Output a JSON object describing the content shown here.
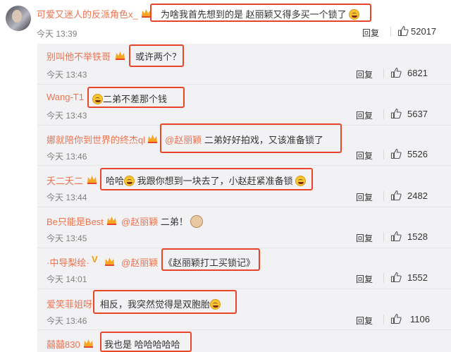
{
  "main_comment": {
    "user": "可爱又迷人的反派角色x_",
    "text": "为啥我首先想到的是 赵丽颖又得多买一个锁了",
    "time": "今天 13:39",
    "reply": "回复",
    "likes": "52017"
  },
  "replies": [
    {
      "user": "别叫他不举铁哥",
      "text": "或许两个？",
      "time": "今天 13:43",
      "reply": "回复",
      "likes": "6821"
    },
    {
      "user": "Wang-T1",
      "text": "二弟不差那个钱",
      "time": "今天 13:43",
      "reply": "回复",
      "likes": "5637"
    },
    {
      "user": "娜就陪你到世界的终杰ql",
      "mention": "@赵丽颖",
      "text": " 二弟好好拍戏，又该准备锁了",
      "time": "今天 13:46",
      "reply": "回复",
      "likes": "5526"
    },
    {
      "user": "夭二夭二",
      "text_a": "哈哈",
      "text_b": " 我跟你想到一块去了，小赵赶紧准备锁",
      "time": "今天 13:44",
      "reply": "回复",
      "likes": "2482"
    },
    {
      "user": "Be只能是Best",
      "mention": "@赵丽颖",
      "text": " 二弟！",
      "time": "今天 13:45",
      "reply": "回复",
      "likes": "1528"
    },
    {
      "user": "·中导梨绘·",
      "mention": "@赵丽颖",
      "text": "《赵丽颖打工买锁记》",
      "time": "今天 14:01",
      "reply": "回复",
      "likes": "1552"
    },
    {
      "user": "爱笑菲姐呀",
      "text": "相反，我突然觉得是双胞胎",
      "time": "今天 13:46",
      "reply": "回复",
      "likes": "1106"
    },
    {
      "user": "囍囍830",
      "text": "我也是 哈哈哈哈哈"
    }
  ],
  "colors": {
    "username": "#eb7350",
    "highlight_box": "#e8452b",
    "panel": "#f2f2f5"
  },
  "icons": {
    "like": "thumbs-up-icon",
    "badge": "member-crown-icon",
    "emoji": "laughing-emoji-icon"
  }
}
